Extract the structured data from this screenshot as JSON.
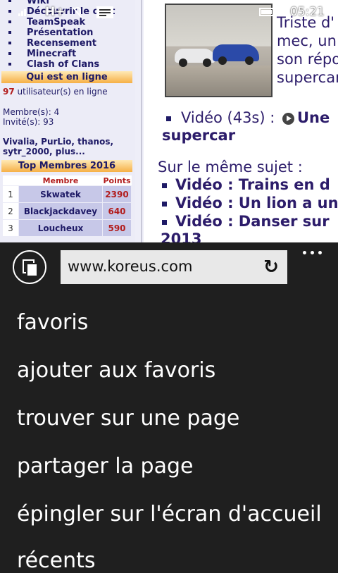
{
  "status_bar": {
    "network": "H+",
    "time": "05:21"
  },
  "left_column": {
    "menu_items": [
      "Wiki",
      "Découvrir le chat",
      "TeamSpeak",
      "Présentation",
      "Recensement",
      "Minecraft",
      "Clash of Clans"
    ],
    "online_header": "Qui est en ligne",
    "online_count": "97",
    "online_label": "utilisateur(s) en ligne",
    "members_line": "Membre(s): 4",
    "guests_line": "Invité(s): 93",
    "online_users": "Vivalia, PurLio, thanos,",
    "online_users_more": "sytr_2000, plus...",
    "top_header": "Top Membres 2016",
    "table_headers": [
      "Membre",
      "Points"
    ],
    "top_members": [
      {
        "rank": "1",
        "name": "Skwatek",
        "points": "2390"
      },
      {
        "rank": "2",
        "name": "Blackjackdavey",
        "points": "640"
      },
      {
        "rank": "3",
        "name": "Loucheux",
        "points": "590"
      }
    ]
  },
  "article": {
    "text_lines": [
      "Triste d'",
      "mec, un",
      "son répo",
      "supercar"
    ],
    "video_label": "Vidéo (43s) :",
    "video_title_part": "Une",
    "video_title_part2": "supercar",
    "related_title": "Sur le même sujet :",
    "related": [
      "Vidéo : Trains en d",
      "Vidéo : Un lion a un",
      "Vidéo : Danser sur"
    ],
    "related_year": "2013"
  },
  "browser": {
    "url": "www.koreus.com",
    "menu": [
      "favoris",
      "ajouter aux favoris",
      "trouver sur une page",
      "partager la page",
      "épingler sur l'écran d'accueil",
      "récents"
    ]
  }
}
